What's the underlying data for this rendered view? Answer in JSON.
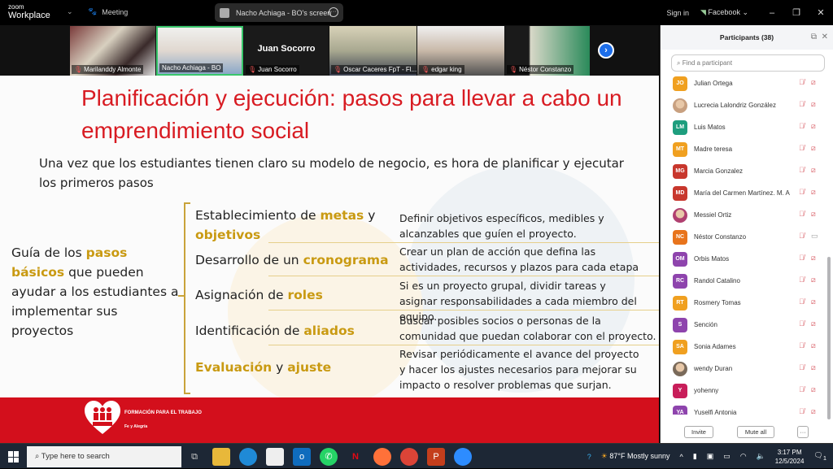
{
  "app": {
    "logo_small": "zoom",
    "logo_big": "Workplace",
    "meeting_label": "Meeting",
    "share_label": "Nacho Achiaga - BO's screen",
    "sign_in": "Sign in",
    "feed": "Facebook"
  },
  "gallery": {
    "tiles": [
      {
        "name": "Marilanddy Almonte",
        "muted": true
      },
      {
        "name": "Nacho Achiaga - BO",
        "muted": false,
        "active": true
      },
      {
        "name": "Juan Socorro",
        "muted": true,
        "display_name": "Juan Socorro"
      },
      {
        "name": "Oscar Caceres FpT - Fl...",
        "muted": true
      },
      {
        "name": "edgar king",
        "muted": true
      },
      {
        "name": "Néstor Constanzo",
        "muted": true
      }
    ]
  },
  "slide": {
    "title": "Planificación y ejecución: pasos para llevar a cabo un emprendimiento social",
    "intro": "Una vez que los estudiantes tienen claro su modelo de negocio, es hora de planificar y ejecutar los primeros pasos",
    "guide": {
      "pre": "Guía de los ",
      "highlight": "pasos básicos",
      "post": " que pueden ayudar a los estudiantes a implementar sus proyectos"
    },
    "steps": [
      {
        "parts": [
          [
            "Establecimiento de ",
            false
          ],
          [
            "metas",
            true
          ],
          [
            " y ",
            false
          ],
          [
            "objetivos",
            true
          ]
        ],
        "desc": "Definir objetivos específicos, medibles y alcanzables que guíen el proyecto."
      },
      {
        "parts": [
          [
            "Desarrollo de un ",
            false
          ],
          [
            "cronograma",
            true
          ]
        ],
        "desc": "Crear un plan de acción que defina las actividades, recursos y plazos para cada etapa"
      },
      {
        "parts": [
          [
            "Asignación de ",
            false
          ],
          [
            "roles",
            true
          ]
        ],
        "desc": "Si es un proyecto grupal, dividir tareas y asignar responsabilidades a cada miembro del equipo."
      },
      {
        "parts": [
          [
            "Identificación de ",
            false
          ],
          [
            "aliados",
            true
          ]
        ],
        "desc": "Buscar posibles socios o personas de la comunidad que puedan colaborar con el proyecto."
      },
      {
        "parts": [
          [
            "Evaluación",
            true
          ],
          [
            " y ",
            false
          ],
          [
            "ajuste",
            true
          ]
        ],
        "desc": "Revisar periódicamente el avance del proyecto y hacer los ajustes necesarios para mejorar su impacto o resolver problemas que surjan."
      }
    ],
    "footer": {
      "line1": "FORMACIÓN PARA EL TRABAJO",
      "line2": "Fe y Alegría",
      "logo_text": "FE Y ALEGRÍA"
    },
    "colors": {
      "title": "#d81b22",
      "highlight": "#c99a12",
      "footer": "#d30f1c"
    }
  },
  "participants": {
    "title": "Participants (38)",
    "search_placeholder": "Find a participant",
    "list": [
      {
        "initials": "JO",
        "name": "Julian Ortega",
        "color": "#f0a020",
        "video_on": false
      },
      {
        "initials": "",
        "name": "Lucrecia Lalondriz González",
        "color": "#c8a080",
        "video_on": false,
        "photo": true
      },
      {
        "initials": "LM",
        "name": "Luis Matos",
        "color": "#1e9e7e",
        "video_on": false
      },
      {
        "initials": "MT",
        "name": "Madre teresa",
        "color": "#f0a020",
        "video_on": false
      },
      {
        "initials": "MG",
        "name": "Marcia Gonzalez",
        "color": "#c8372d",
        "video_on": false
      },
      {
        "initials": "MD",
        "name": "María del Carmen Martínez. M. A",
        "color": "#c8372d",
        "video_on": false
      },
      {
        "initials": "",
        "name": "Messiel Ortiz",
        "color": "#b04070",
        "video_on": false,
        "photo": true
      },
      {
        "initials": "NC",
        "name": "Néstor Constanzo",
        "color": "#e8741c",
        "video_on": true
      },
      {
        "initials": "OM",
        "name": "Orbis Matos",
        "color": "#8e44ad",
        "video_on": false
      },
      {
        "initials": "RC",
        "name": "Randol Catalino",
        "color": "#8e44ad",
        "video_on": false
      },
      {
        "initials": "RT",
        "name": "Rosmery Tomas",
        "color": "#f0a020",
        "video_on": false
      },
      {
        "initials": "S",
        "name": "Sención",
        "color": "#8e44ad",
        "video_on": false
      },
      {
        "initials": "SA",
        "name": "Sonia Adames",
        "color": "#f0a020",
        "video_on": false
      },
      {
        "initials": "",
        "name": "wendy Duran",
        "color": "#7a6a5a",
        "video_on": false,
        "photo": true
      },
      {
        "initials": "Y",
        "name": "yohenny",
        "color": "#c81e5a",
        "video_on": false
      },
      {
        "initials": "YA",
        "name": "Yuselfi Antonia",
        "color": "#8e44ad",
        "video_on": false
      }
    ],
    "invite": "Invite",
    "mute_all": "Mute all",
    "more": "···"
  },
  "taskbar": {
    "search_placeholder": "Type here to search",
    "weather": "87°F  Mostly sunny",
    "time": "3:17 PM",
    "date": "12/5/2024",
    "notifications": "1"
  }
}
